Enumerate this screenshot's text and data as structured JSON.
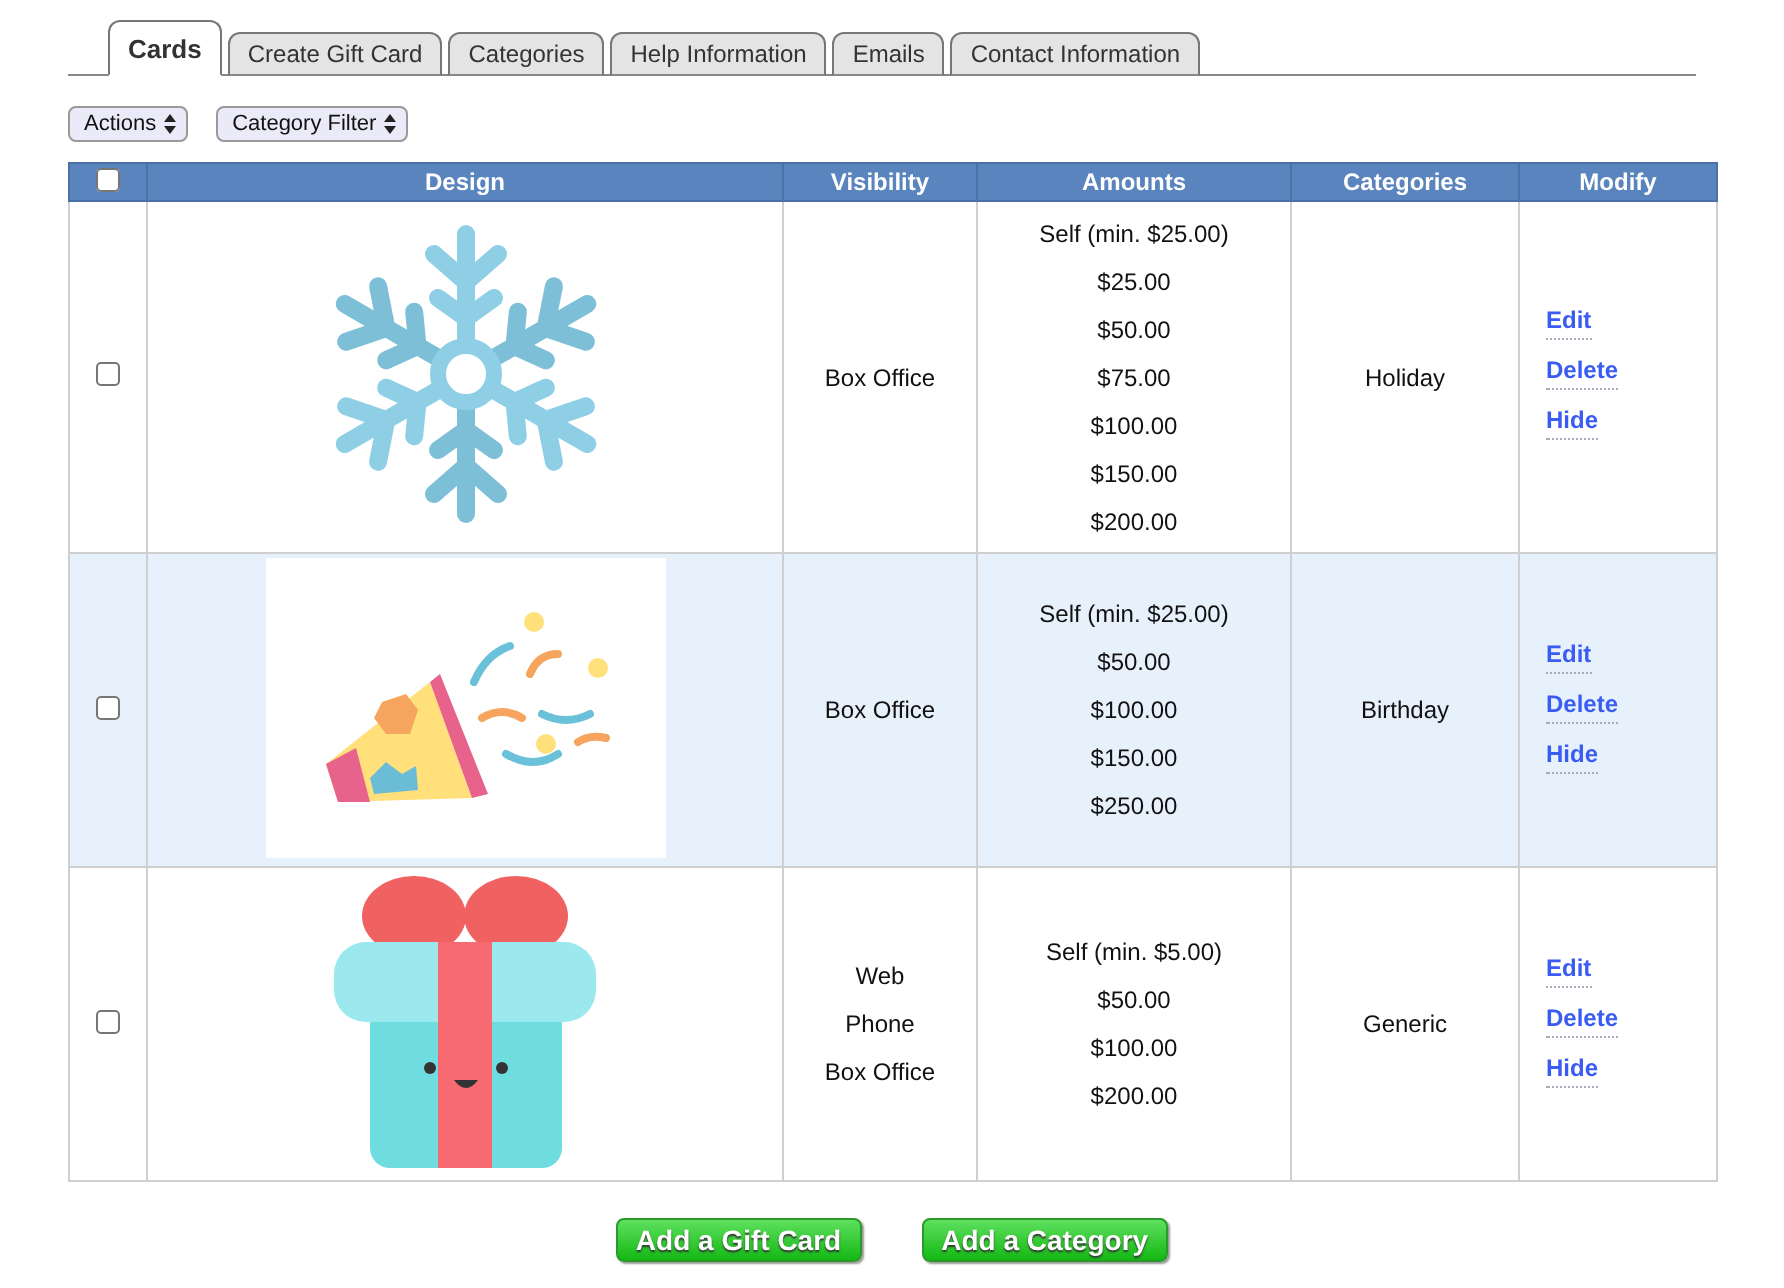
{
  "tabs": [
    {
      "label": "Cards",
      "selected": true
    },
    {
      "label": "Create Gift Card",
      "selected": false
    },
    {
      "label": "Categories",
      "selected": false
    },
    {
      "label": "Help Information",
      "selected": false
    },
    {
      "label": "Emails",
      "selected": false
    },
    {
      "label": "Contact Information",
      "selected": false
    }
  ],
  "filters": [
    "Actions",
    "Category Filter"
  ],
  "table": {
    "select_all_checked": false,
    "columns": [
      "Design",
      "Visibility",
      "Amounts",
      "Categories",
      "Modify"
    ],
    "rows": [
      {
        "checked": false,
        "highlighted": false,
        "kind": "snowflake",
        "visibility": [
          "Box Office"
        ],
        "amounts": [
          "Self (min. $25.00)",
          "$25.00",
          "$50.00",
          "$75.00",
          "$100.00",
          "$150.00",
          "$200.00"
        ],
        "category": "Holiday",
        "actions": [
          "Edit",
          "Delete",
          "Hide"
        ]
      },
      {
        "checked": false,
        "highlighted": true,
        "kind": "popper",
        "visibility": [
          "Box Office"
        ],
        "amounts": [
          "Self (min. $25.00)",
          "$50.00",
          "$100.00",
          "$150.00",
          "$250.00"
        ],
        "category": "Birthday",
        "actions": [
          "Edit",
          "Delete",
          "Hide"
        ]
      },
      {
        "checked": false,
        "highlighted": false,
        "kind": "gift",
        "visibility": [
          "Web",
          "Phone",
          "Box Office"
        ],
        "amounts": [
          "Self (min. $5.00)",
          "$50.00",
          "$100.00",
          "$200.00"
        ],
        "category": "Generic",
        "actions": [
          "Edit",
          "Delete",
          "Hide"
        ]
      }
    ]
  },
  "buttons": [
    "Add a Gift Card",
    "Add a Category"
  ]
}
